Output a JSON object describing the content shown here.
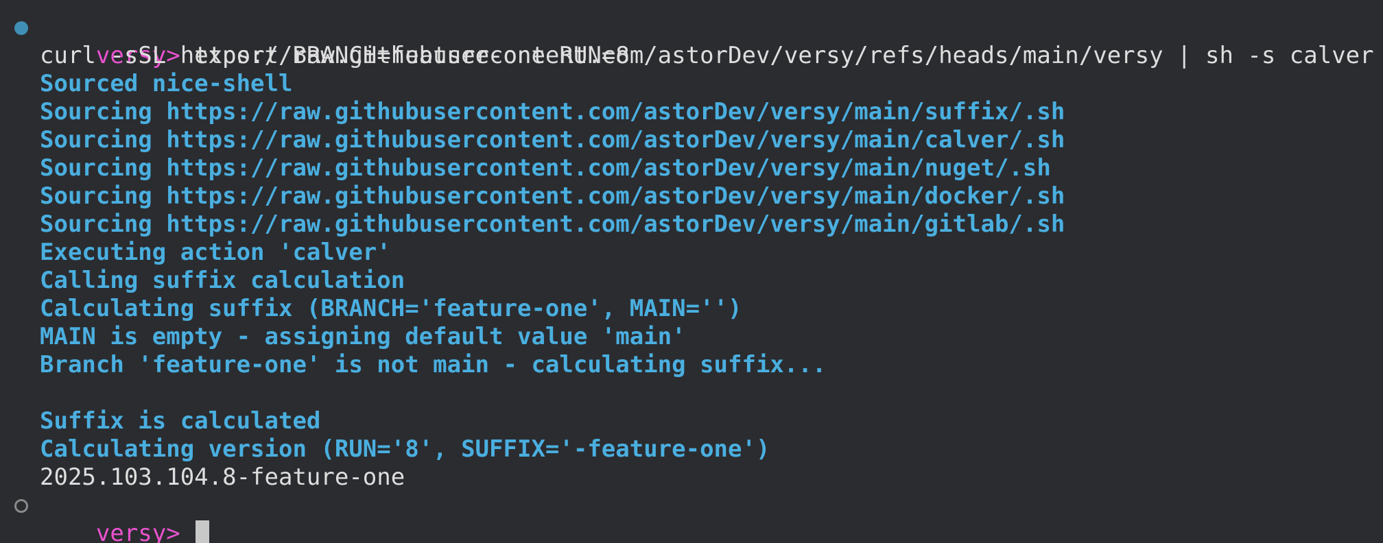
{
  "prompt": {
    "label": "versy>",
    "color": "#ea52cf"
  },
  "command_block": {
    "line1": "export BRANCH=feature-one RUN=8",
    "line2": "curl -sSL https://raw.githubusercontent.com/astorDev/versy/refs/heads/main/versy | sh -s calver"
  },
  "output": [
    "Sourced nice-shell",
    "Sourcing https://raw.githubusercontent.com/astorDev/versy/main/suffix/.sh",
    "Sourcing https://raw.githubusercontent.com/astorDev/versy/main/calver/.sh",
    "Sourcing https://raw.githubusercontent.com/astorDev/versy/main/nuget/.sh",
    "Sourcing https://raw.githubusercontent.com/astorDev/versy/main/docker/.sh",
    "Sourcing https://raw.githubusercontent.com/astorDev/versy/main/gitlab/.sh",
    "Executing action 'calver'",
    "Calling suffix calculation",
    "Calculating suffix (BRANCH='feature-one', MAIN='')",
    "MAIN is empty - assigning default value 'main'",
    "Branch 'feature-one' is not main - calculating suffix...",
    "",
    "Suffix is calculated",
    "Calculating version (RUN='8', SUFFIX='-feature-one')"
  ],
  "result": "2025.103.104.8-feature-one",
  "colors": {
    "background": "#2b2c30",
    "output_text": "#4aafe0",
    "plain_text": "#dedede",
    "marker_filled": "#3f8fb6",
    "marker_empty": "#8a8a8a"
  }
}
